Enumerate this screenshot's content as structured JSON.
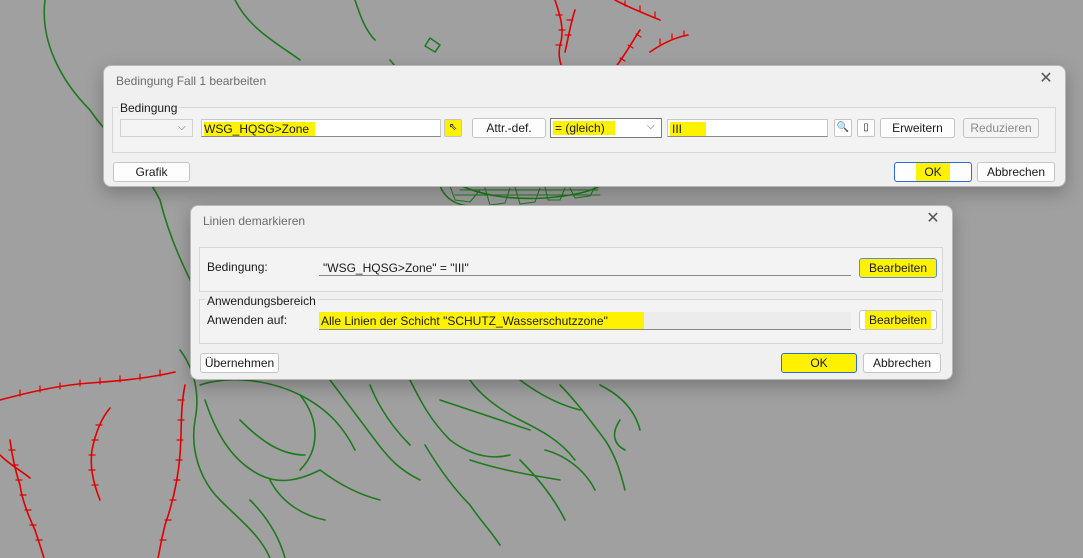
{
  "dialog1": {
    "title": "Bedingung Fall 1 bearbeiten",
    "close_label": "✕",
    "group_label": "Bedingung",
    "prefix_combo_value": "",
    "attribute_value": "WSG_HQSG>Zone",
    "pick_icon": "cursor-pick-icon",
    "attr_def_label": "Attr.-def.",
    "operator_value": "= (gleich)",
    "value_input": "III",
    "search_icon": "magnifier-icon",
    "info_icon": "info-icon",
    "extend_label": "Erweitern",
    "reduce_label": "Reduzieren",
    "graphic_label": "Grafik",
    "ok_label": "OK",
    "cancel_label": "Abbrechen"
  },
  "dialog2": {
    "title": "Linien demarkieren",
    "close_label": "✕",
    "condition_label": "Bedingung:",
    "condition_value": "\"WSG_HQSG>Zone\" = \"III\"",
    "edit_condition_label": "Bearbeiten",
    "scope_group_label": "Anwendungsbereich",
    "apply_to_label": "Anwenden auf:",
    "apply_to_value": "Alle Linien der Schicht \"SCHUTZ_Wasserschutzzone\"",
    "edit_scope_label": "Bearbeiten",
    "apply_label": "Übernehmen",
    "ok_label": "OK",
    "cancel_label": "Abbrechen"
  },
  "colors": {
    "highlight": "#fff200",
    "map_background": "#a0a0a0",
    "green_lines": "#1f7a1f",
    "red_lines": "#e00000"
  }
}
